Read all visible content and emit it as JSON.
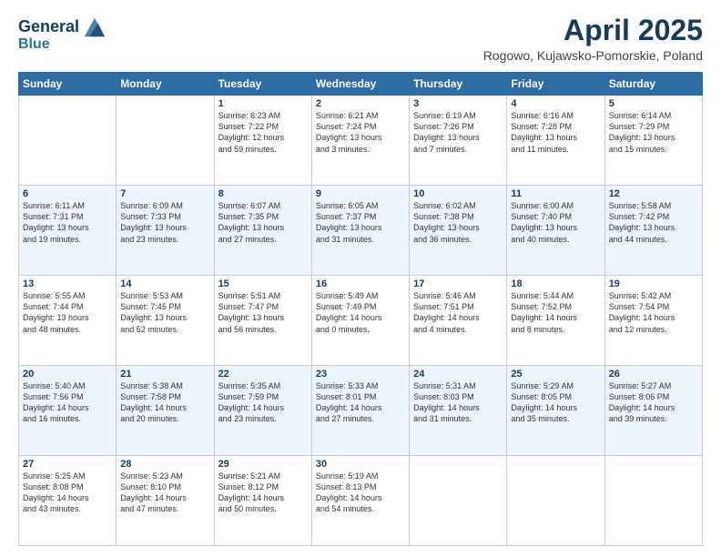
{
  "header": {
    "logo_line1": "General",
    "logo_line2": "Blue",
    "month_title": "April 2025",
    "location": "Rogowo, Kujawsko-Pomorskie, Poland"
  },
  "days_of_week": [
    "Sunday",
    "Monday",
    "Tuesday",
    "Wednesday",
    "Thursday",
    "Friday",
    "Saturday"
  ],
  "weeks": [
    [
      {
        "day": "",
        "info": ""
      },
      {
        "day": "",
        "info": ""
      },
      {
        "day": "1",
        "info": "Sunrise: 6:23 AM\nSunset: 7:22 PM\nDaylight: 12 hours\nand 59 minutes."
      },
      {
        "day": "2",
        "info": "Sunrise: 6:21 AM\nSunset: 7:24 PM\nDaylight: 13 hours\nand 3 minutes."
      },
      {
        "day": "3",
        "info": "Sunrise: 6:19 AM\nSunset: 7:26 PM\nDaylight: 13 hours\nand 7 minutes."
      },
      {
        "day": "4",
        "info": "Sunrise: 6:16 AM\nSunset: 7:28 PM\nDaylight: 13 hours\nand 11 minutes."
      },
      {
        "day": "5",
        "info": "Sunrise: 6:14 AM\nSunset: 7:29 PM\nDaylight: 13 hours\nand 15 minutes."
      }
    ],
    [
      {
        "day": "6",
        "info": "Sunrise: 6:11 AM\nSunset: 7:31 PM\nDaylight: 13 hours\nand 19 minutes."
      },
      {
        "day": "7",
        "info": "Sunrise: 6:09 AM\nSunset: 7:33 PM\nDaylight: 13 hours\nand 23 minutes."
      },
      {
        "day": "8",
        "info": "Sunrise: 6:07 AM\nSunset: 7:35 PM\nDaylight: 13 hours\nand 27 minutes."
      },
      {
        "day": "9",
        "info": "Sunrise: 6:05 AM\nSunset: 7:37 PM\nDaylight: 13 hours\nand 31 minutes."
      },
      {
        "day": "10",
        "info": "Sunrise: 6:02 AM\nSunset: 7:38 PM\nDaylight: 13 hours\nand 36 minutes."
      },
      {
        "day": "11",
        "info": "Sunrise: 6:00 AM\nSunset: 7:40 PM\nDaylight: 13 hours\nand 40 minutes."
      },
      {
        "day": "12",
        "info": "Sunrise: 5:58 AM\nSunset: 7:42 PM\nDaylight: 13 hours\nand 44 minutes."
      }
    ],
    [
      {
        "day": "13",
        "info": "Sunrise: 5:55 AM\nSunset: 7:44 PM\nDaylight: 13 hours\nand 48 minutes."
      },
      {
        "day": "14",
        "info": "Sunrise: 5:53 AM\nSunset: 7:45 PM\nDaylight: 13 hours\nand 52 minutes."
      },
      {
        "day": "15",
        "info": "Sunrise: 5:51 AM\nSunset: 7:47 PM\nDaylight: 13 hours\nand 56 minutes."
      },
      {
        "day": "16",
        "info": "Sunrise: 5:49 AM\nSunset: 7:49 PM\nDaylight: 14 hours\nand 0 minutes."
      },
      {
        "day": "17",
        "info": "Sunrise: 5:46 AM\nSunset: 7:51 PM\nDaylight: 14 hours\nand 4 minutes."
      },
      {
        "day": "18",
        "info": "Sunrise: 5:44 AM\nSunset: 7:52 PM\nDaylight: 14 hours\nand 8 minutes."
      },
      {
        "day": "19",
        "info": "Sunrise: 5:42 AM\nSunset: 7:54 PM\nDaylight: 14 hours\nand 12 minutes."
      }
    ],
    [
      {
        "day": "20",
        "info": "Sunrise: 5:40 AM\nSunset: 7:56 PM\nDaylight: 14 hours\nand 16 minutes."
      },
      {
        "day": "21",
        "info": "Sunrise: 5:38 AM\nSunset: 7:58 PM\nDaylight: 14 hours\nand 20 minutes."
      },
      {
        "day": "22",
        "info": "Sunrise: 5:35 AM\nSunset: 7:59 PM\nDaylight: 14 hours\nand 23 minutes."
      },
      {
        "day": "23",
        "info": "Sunrise: 5:33 AM\nSunset: 8:01 PM\nDaylight: 14 hours\nand 27 minutes."
      },
      {
        "day": "24",
        "info": "Sunrise: 5:31 AM\nSunset: 8:03 PM\nDaylight: 14 hours\nand 31 minutes."
      },
      {
        "day": "25",
        "info": "Sunrise: 5:29 AM\nSunset: 8:05 PM\nDaylight: 14 hours\nand 35 minutes."
      },
      {
        "day": "26",
        "info": "Sunrise: 5:27 AM\nSunset: 8:06 PM\nDaylight: 14 hours\nand 39 minutes."
      }
    ],
    [
      {
        "day": "27",
        "info": "Sunrise: 5:25 AM\nSunset: 8:08 PM\nDaylight: 14 hours\nand 43 minutes."
      },
      {
        "day": "28",
        "info": "Sunrise: 5:23 AM\nSunset: 8:10 PM\nDaylight: 14 hours\nand 47 minutes."
      },
      {
        "day": "29",
        "info": "Sunrise: 5:21 AM\nSunset: 8:12 PM\nDaylight: 14 hours\nand 50 minutes."
      },
      {
        "day": "30",
        "info": "Sunrise: 5:19 AM\nSunset: 8:13 PM\nDaylight: 14 hours\nand 54 minutes."
      },
      {
        "day": "",
        "info": ""
      },
      {
        "day": "",
        "info": ""
      },
      {
        "day": "",
        "info": ""
      }
    ]
  ]
}
